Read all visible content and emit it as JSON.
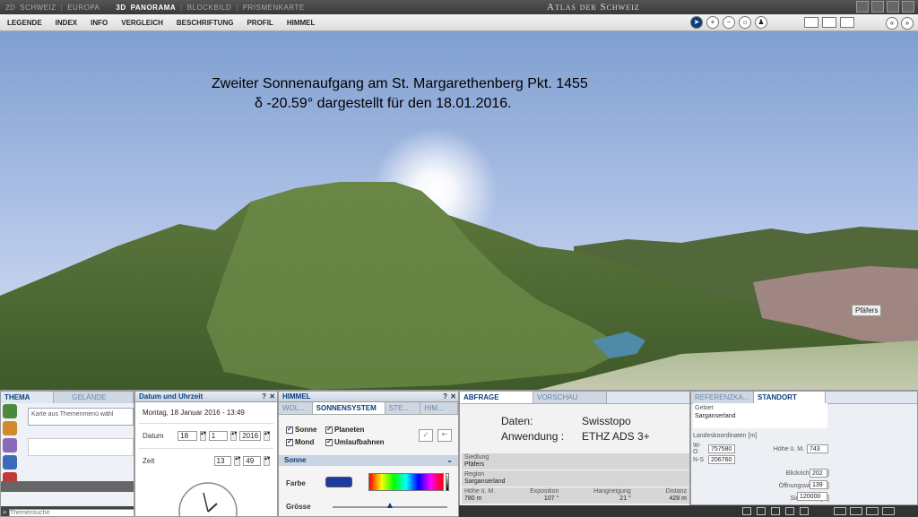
{
  "topbar": {
    "modes": [
      {
        "label": "2D",
        "active": false
      },
      {
        "label": "SCHWEIZ",
        "active": false
      },
      {
        "label": "EUROPA",
        "active": false
      },
      {
        "label": "3D",
        "active": true
      },
      {
        "label": "PANORAMA",
        "active": true
      },
      {
        "label": "BLOCKBILD",
        "active": false
      },
      {
        "label": "PRISMENKARTE",
        "active": false
      }
    ],
    "brand": "Atlas der Schweiz",
    "window_buttons": [
      "minimize-icon",
      "maximize-icon",
      "restore-icon",
      "close-icon"
    ]
  },
  "menu": {
    "items": [
      "LEGENDE",
      "INDEX",
      "INFO",
      "VERGLEICH",
      "BESCHRIFTUNG",
      "PROFIL",
      "HIMMEL"
    ],
    "tools": [
      "pointer-icon",
      "zoom-in-icon",
      "zoom-out-icon",
      "sun-icon",
      "person-icon"
    ],
    "view_tools": [
      "window-icon",
      "split-icon",
      "box-icon"
    ],
    "nav_tools": [
      "back-icon",
      "forward-icon"
    ]
  },
  "scene": {
    "caption_line1": "Zweiter Sonnenaufgang am St. Margarethenberg Pkt. 1455",
    "caption_line2": "δ -20.59° dargestellt für den 18.01.2016.",
    "place_label": "Pfäfers"
  },
  "thema": {
    "tabs": [
      "THEMA",
      "GELÄNDE"
    ],
    "hint": "Karte aus Themenmenü wähl",
    "search_placeholder": "Themensuche"
  },
  "datetime": {
    "title": "Datum und Uhrzeit",
    "help": "?",
    "close": "✕",
    "display": "Montag, 18 Januar 2016 - 13:49",
    "date_label": "Datum",
    "day": "18",
    "month": "1",
    "year": "2016",
    "time_label": "Zeit",
    "hour": "13",
    "minute": "49"
  },
  "himmel": {
    "title": "HIMMEL",
    "help": "?",
    "close": "✕",
    "tabs": [
      "WOL...",
      "SONNENSYSTEM",
      "STE...",
      "HIM..."
    ],
    "checks": [
      "Sonne",
      "Mond",
      "Planeten",
      "Umlaufbahnen"
    ],
    "section": "Sonne",
    "farbe_label": "Farbe",
    "farbe_color": "#1c3aa0",
    "groesse_label": "Grösse",
    "groesse_level": 0.5
  },
  "abfrage": {
    "tabs": [
      "ABFRAGE",
      "VORSCHAU"
    ],
    "info_labels": [
      "Daten:",
      "Anwendung :"
    ],
    "info_values": [
      "Swisstopo",
      "ETHZ ADS 3+"
    ],
    "siedlung_label": "Siedlung",
    "siedlung_value": "Pfäfers",
    "region_label": "Region",
    "region_value": "Sarganserland",
    "metrics": [
      {
        "label": "Höhe ü. M.",
        "value": "780 m"
      },
      {
        "label": "Exposition",
        "value": "107 °"
      },
      {
        "label": "Hangneigung",
        "value": "21 °"
      },
      {
        "label": "Distanz",
        "value": "428 m"
      }
    ]
  },
  "standort": {
    "tabs": [
      "REFERENZKA...",
      "STANDORT"
    ],
    "gebiet_label": "Gebiet",
    "gebiet_value": "Sarganserland",
    "landes_label": "Landeskoordinaten [m]",
    "wo_label": "W-O",
    "wo_value": "757580",
    "hoehe_label": "Höhe ü. M.",
    "hoehe_value": "743",
    "ns_label": "N-S",
    "ns_value": "206760",
    "blick_label": "Blickrichtung [°]",
    "blick_value": "202",
    "oeff_label": "Öffnungswinkel [°]",
    "oeff_value": "139",
    "sicht_label": "Sichtweite [m]",
    "sicht_value": "120000"
  }
}
